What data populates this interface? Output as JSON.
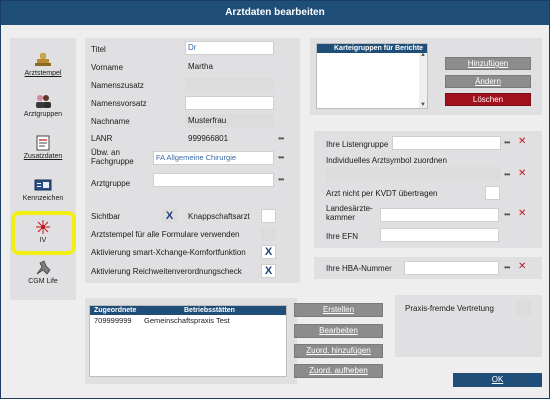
{
  "window": {
    "title": "Arztdaten bearbeiten"
  },
  "sidebar": {
    "items": [
      {
        "label": "Arztstempel",
        "icon": "stamp-icon"
      },
      {
        "label": "Arztgruppen",
        "icon": "users-icon"
      },
      {
        "label": "Zusatzdaten",
        "icon": "document-icon"
      },
      {
        "label": "Kennzeichen",
        "icon": "id-card-icon"
      },
      {
        "label": "IV",
        "icon": "network-icon"
      },
      {
        "label": "CGM Life",
        "icon": "cgm-life-icon"
      }
    ]
  },
  "form": {
    "titel_label": "Titel",
    "titel_value": "Dr",
    "vorname_label": "Vorname",
    "vorname_value": "Martha",
    "namenszusatz_label": "Namenszusatz",
    "namensvorsatz_label": "Namensvorsatz",
    "nachname_label": "Nachname",
    "nachname_value": "Musterfrau",
    "lanr_label": "LANR",
    "lanr_value": "999966801",
    "fachgruppe_label_1": "Übw. an",
    "fachgruppe_label_2": "Fachgruppe",
    "fachgruppe_value": "FA Allgemeine Chirurgie",
    "arztgruppe_label": "Arztgruppe",
    "sichtbar_label": "Sichtbar",
    "sichtbar_mark": "X",
    "knappschaft_label": "Knappschaftsarzt",
    "arztstempel_label": "Arztstempel für alle Formulare verwenden",
    "smartx_label": "Aktivierung smart-Xchange-Komfortfunktion",
    "smartx_mark": "X",
    "reichweite_label": "Aktivierung Reichweitenverordnungscheck",
    "reichweite_mark": "X",
    "dots": "•••"
  },
  "kartei": {
    "header": "Karteigruppen für Berichte",
    "add_label": "Hinzufügen",
    "edit_label": "Ändern",
    "delete_label": "Löschen"
  },
  "right": {
    "listengruppe_label": "Ihre Listengruppe",
    "arztsymbol_label": "Individuelles Arztsymbol zuordnen",
    "kvdt_label": "Arzt nicht per KVDT übertragen",
    "kammer_label_1": "Landesärzte-",
    "kammer_label_2": "kammer",
    "efn_label": "Ihre EFN",
    "hba_label": "Ihre HBA-Nummer",
    "x_mark": "✕"
  },
  "zuord": {
    "col1": "Zugeordnete",
    "col2": "Betriebsstätten",
    "rows": [
      {
        "id": "709999999",
        "name": "Gemeinschaftspraxis Test"
      }
    ],
    "erstellen": "Erstellen",
    "bearbeiten": "Bearbeiten",
    "hinzufuegen": "Zuord. hinzufügen",
    "aufheben": "Zuord. aufheben"
  },
  "praxis": {
    "label": "Praxis-fremde Vertretung"
  },
  "ok_label": "OK",
  "colors": {
    "title": "#1f4e79",
    "accent": "#1f4e79",
    "danger": "#a0111b",
    "highlight": "#f3ef14"
  }
}
